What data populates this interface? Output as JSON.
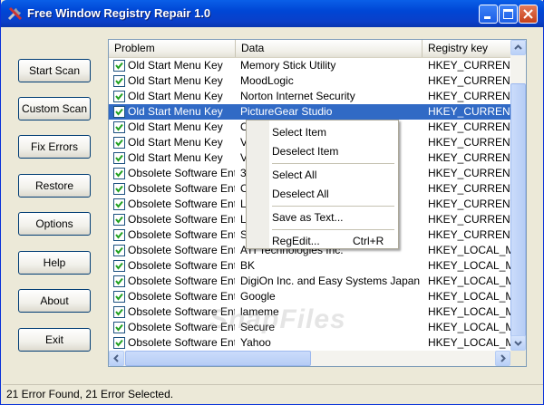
{
  "window": {
    "title": "Free Window Registry Repair 1.0"
  },
  "sidebar": {
    "buttons": [
      {
        "label": "Start Scan"
      },
      {
        "label": "Custom Scan"
      },
      {
        "label": "Fix Errors"
      },
      {
        "label": "Restore"
      },
      {
        "label": "Options"
      },
      {
        "label": "Help"
      },
      {
        "label": "About"
      },
      {
        "label": "Exit"
      }
    ]
  },
  "table": {
    "columns": [
      "Problem",
      "Data",
      "Registry key"
    ],
    "rows": [
      {
        "problem": "Old Start Menu Key",
        "data": "Memory Stick Utility",
        "key": "HKEY_CURRENT_"
      },
      {
        "problem": "Old Start Menu Key",
        "data": "MoodLogic",
        "key": "HKEY_CURRENT_"
      },
      {
        "problem": "Old Start Menu Key",
        "data": "Norton Internet Security",
        "key": "HKEY_CURRENT_"
      },
      {
        "problem": "Old Start Menu Key",
        "data": "PictureGear Studio",
        "key": "HKEY_CURRENT_"
      },
      {
        "problem": "Old Start Menu Key",
        "data": "C",
        "key": "HKEY_CURRENT_"
      },
      {
        "problem": "Old Start Menu Key",
        "data": "V",
        "key": "HKEY_CURRENT_"
      },
      {
        "problem": "Old Start Menu Key",
        "data": "V",
        "key": "HKEY_CURRENT_"
      },
      {
        "problem": "Obsolete Software Entry",
        "data": "3",
        "key": "HKEY_CURRENT_"
      },
      {
        "problem": "Obsolete Software Entry",
        "data": "C",
        "key": "HKEY_CURRENT_"
      },
      {
        "problem": "Obsolete Software Entry",
        "data": "L",
        "key": "HKEY_CURRENT_"
      },
      {
        "problem": "Obsolete Software Entry",
        "data": "L                                        ions",
        "key": "HKEY_CURRENT_"
      },
      {
        "problem": "Obsolete Software Entry",
        "data": "S",
        "key": "HKEY_CURRENT_"
      },
      {
        "problem": "Obsolete Software Entry",
        "data": "ATI Technologies Inc.",
        "key": "HKEY_LOCAL_MA"
      },
      {
        "problem": "Obsolete Software Entry",
        "data": "BK",
        "key": "HKEY_LOCAL_MA"
      },
      {
        "problem": "Obsolete Software Entry",
        "data": "DigiOn Inc. and Easy Systems Japan Ltd.",
        "key": "HKEY_LOCAL_MA"
      },
      {
        "problem": "Obsolete Software Entry",
        "data": "Google",
        "key": "HKEY_LOCAL_MA"
      },
      {
        "problem": "Obsolete Software Entry",
        "data": "lameme",
        "key": "HKEY_LOCAL_MA"
      },
      {
        "problem": "Obsolete Software Entry",
        "data": "Secure",
        "key": "HKEY_LOCAL_MA"
      },
      {
        "problem": "Obsolete Software Entry",
        "data": "Yahoo",
        "key": "HKEY_LOCAL_MA"
      }
    ],
    "selected_index": 3
  },
  "context_menu": {
    "select_item": "Select Item",
    "deselect_item": "Deselect Item",
    "select_all": "Select All",
    "deselect_all": "Deselect All",
    "save_as_text": "Save as Text...",
    "regedit": "RegEdit...",
    "regedit_shortcut": "Ctrl+R"
  },
  "status": {
    "text": "21 Error Found,  21 Error Selected."
  },
  "watermark": "SnapFiles",
  "colors": {
    "titlebar": "#0a3fc8",
    "selection": "#316ac5",
    "face": "#ece9d8"
  }
}
